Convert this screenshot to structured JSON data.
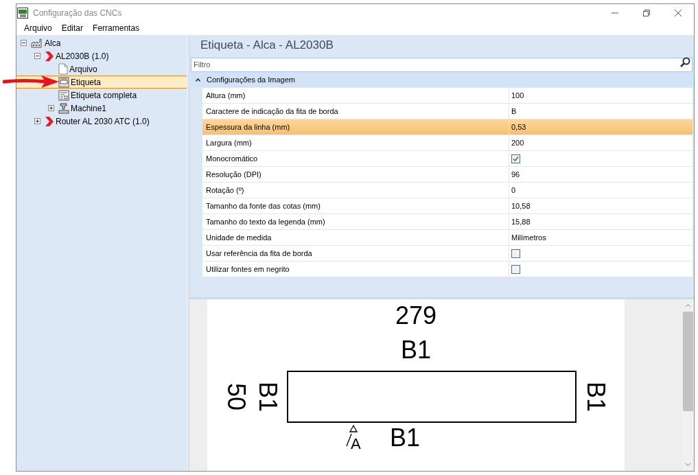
{
  "window": {
    "title": "Configuração das CNCs"
  },
  "menu": [
    "Arquivo",
    "Editar",
    "Ferramentas"
  ],
  "tree": [
    {
      "label": "Alca",
      "kind": "factory",
      "expanded": true,
      "selected": false,
      "children": [
        {
          "label": "AL2030B (1.0)",
          "kind": "chevron",
          "expanded": true,
          "selected": false,
          "children": [
            {
              "label": "Arquivo",
              "kind": "file",
              "selected": false
            },
            {
              "label": "Etiqueta",
              "kind": "label",
              "selected": true
            },
            {
              "label": "Etiqueta completa",
              "kind": "document",
              "selected": false
            },
            {
              "label": "Machine1",
              "kind": "machine",
              "expanded": false,
              "selected": false
            }
          ]
        },
        {
          "label": "Router AL 2030 ATC (1.0)",
          "kind": "chevron",
          "expanded": false,
          "selected": false
        }
      ]
    }
  ],
  "panel": {
    "title": "Etiqueta - Alca - AL2030B",
    "filter": {
      "placeholder": "Filtro"
    },
    "group": {
      "label": "Configurações da Imagem",
      "expanded": true
    },
    "properties": [
      {
        "kind": "text",
        "label": "Altura (mm)",
        "value": "100",
        "selected": false
      },
      {
        "kind": "text",
        "label": "Caractere de indicação da fita de borda",
        "value": "B",
        "selected": false
      },
      {
        "kind": "text",
        "label": "Espessura da linha (mm)",
        "value": "0,53",
        "selected": true
      },
      {
        "kind": "text",
        "label": "Largura (mm)",
        "value": "200",
        "selected": false
      },
      {
        "kind": "checkbox",
        "label": "Monocromático",
        "checked": true,
        "selected": false
      },
      {
        "kind": "text",
        "label": "Resolução (DPI)",
        "value": "96",
        "selected": false
      },
      {
        "kind": "text",
        "label": "Rotação (º)",
        "value": "0",
        "selected": false
      },
      {
        "kind": "text",
        "label": "Tamanho da fonte das cotas (mm)",
        "value": "10,58",
        "selected": false
      },
      {
        "kind": "text",
        "label": "Tamanho do texto da legenda (mm)",
        "value": "15,88",
        "selected": false
      },
      {
        "kind": "text",
        "label": "Unidade de medida",
        "value": "Milímetros",
        "selected": false
      },
      {
        "kind": "checkbox",
        "label": "Usar referência da fita de borda",
        "checked": false,
        "selected": false
      },
      {
        "kind": "checkbox",
        "label": "Utilizar fontes em negrito",
        "checked": false,
        "selected": false
      }
    ]
  },
  "preview": {
    "top_dimension": "279",
    "top_edge": "B1",
    "left_dimension": "50",
    "left_edge": "B1",
    "right_edge": "B1",
    "bottom_edge": "B1",
    "grain_mark": "A"
  }
}
